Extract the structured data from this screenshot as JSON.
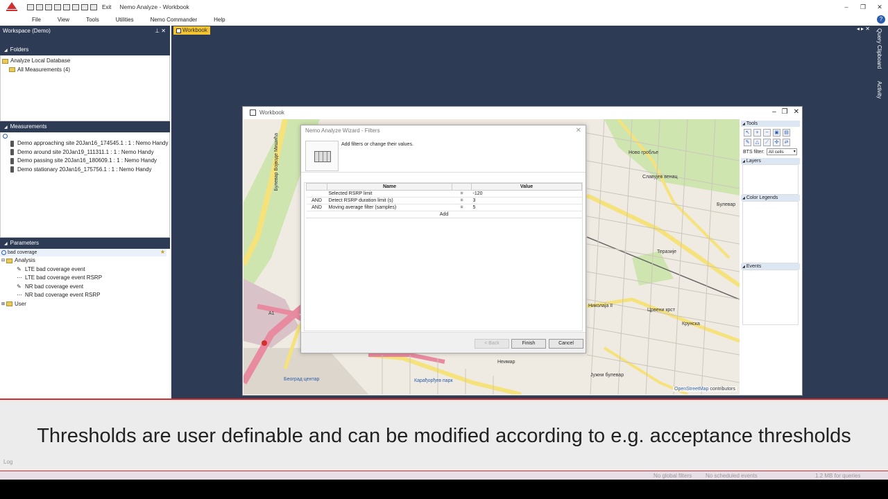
{
  "app": {
    "title": "Nemo Analyze - Workbook",
    "exit_label": "Exit",
    "window_controls": [
      "–",
      "❐",
      "✕"
    ]
  },
  "menu": [
    "File",
    "View",
    "Tools",
    "Utilities",
    "Nemo Commander",
    "Help"
  ],
  "workspace": {
    "title": "Workspace (Demo)",
    "folders_header": "Folders",
    "folders": [
      "Analyze Local Database",
      "All Measurements (4)"
    ],
    "measurements_header": "Measurements",
    "measurements": [
      "Demo approaching site 20Jan16_174545.1 : 1 : Nemo Handy",
      "Demo around site 20Jan19_111311.1 : 1 : Nemo Handy",
      "Demo passing site 20Jan16_180609.1 : 1 : Nemo Handy",
      "Demo stationary 20Jan16_175756.1 : 1 : Nemo Handy"
    ],
    "parameters_header": "Parameters",
    "parameter_search": "bad coverage",
    "parameter_tree": {
      "analysis": "Analysis",
      "events": [
        "LTE bad coverage event",
        "LTE bad coverage event RSRP",
        "NR bad coverage event",
        "NR bad coverage event RSRP"
      ],
      "user": "User"
    }
  },
  "doc_tab": "Workbook",
  "right_strip": [
    "Query Clipboard",
    "Activity"
  ],
  "workbook": {
    "title": "Workbook",
    "tools_header": "Tools",
    "bts_filter_label": "BTS filter:",
    "bts_filter_value": "All cells",
    "layers_header": "Layers",
    "color_legends_header": "Color Legends",
    "events_header": "Events",
    "map_attribution_link": "OpenStreetMap",
    "map_attribution_rest": " contributors",
    "map_labels": [
      "Ново гробље",
      "Славујев венац",
      "Булевар",
      "Теразије",
      "Николаја II",
      "Црвени крст",
      "Крунска",
      "Неимар",
      "Јужни булевар",
      "Карађорђев парк",
      "Београд центар",
      "Булевар Војводе Мишића",
      "A1"
    ]
  },
  "dialog": {
    "title": "Nemo Analyze Wizard - Filters",
    "description": "Add filters or change their values.",
    "columns": [
      "",
      "Name",
      "",
      "Value"
    ],
    "rows": [
      {
        "op": "",
        "name": "Selected RSRP limit",
        "eq": "=",
        "value": "-120"
      },
      {
        "op": "AND",
        "name": "Detect RSRP duration limit (s)",
        "eq": "=",
        "value": "3"
      },
      {
        "op": "AND",
        "name": "Moving average filter (samples)",
        "eq": "=",
        "value": "5"
      }
    ],
    "add_label": "Add",
    "back_label": "< Back",
    "finish_label": "Finish",
    "cancel_label": "Cancel"
  },
  "caption": "Thresholds are user definable and can be modified according to e.g. acceptance thresholds",
  "status": {
    "log": "Log",
    "global_filters": "No global filters",
    "scheduled_events": "No scheduled events",
    "memory": "1.2 MB for queries"
  }
}
